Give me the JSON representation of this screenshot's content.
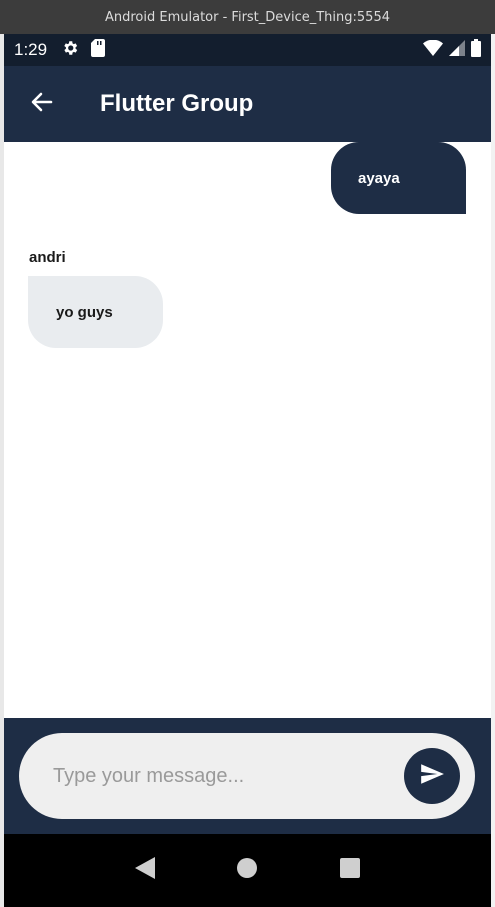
{
  "window": {
    "title": "Android Emulator - First_Device_Thing:5554"
  },
  "statusbar": {
    "time": "1:29"
  },
  "appbar": {
    "title": "Flutter Group"
  },
  "messages": [
    {
      "direction": "outgoing",
      "text": "ayaya"
    },
    {
      "direction": "incoming",
      "sender": "andri",
      "text": "yo guys"
    }
  ],
  "composer": {
    "placeholder": "Type your message..."
  },
  "colors": {
    "primary": "#1e2d45",
    "incoming_bubble": "#e9ecef",
    "input_bg": "#efefef"
  },
  "icons": {
    "back": "arrow-left-icon",
    "send": "send-icon",
    "settings": "gear-icon",
    "sd": "sd-card-icon",
    "wifi": "wifi-icon",
    "signal": "signal-icon",
    "battery": "battery-icon",
    "nav_back": "triangle-back-icon",
    "nav_home": "circle-home-icon",
    "nav_recents": "square-recents-icon"
  }
}
